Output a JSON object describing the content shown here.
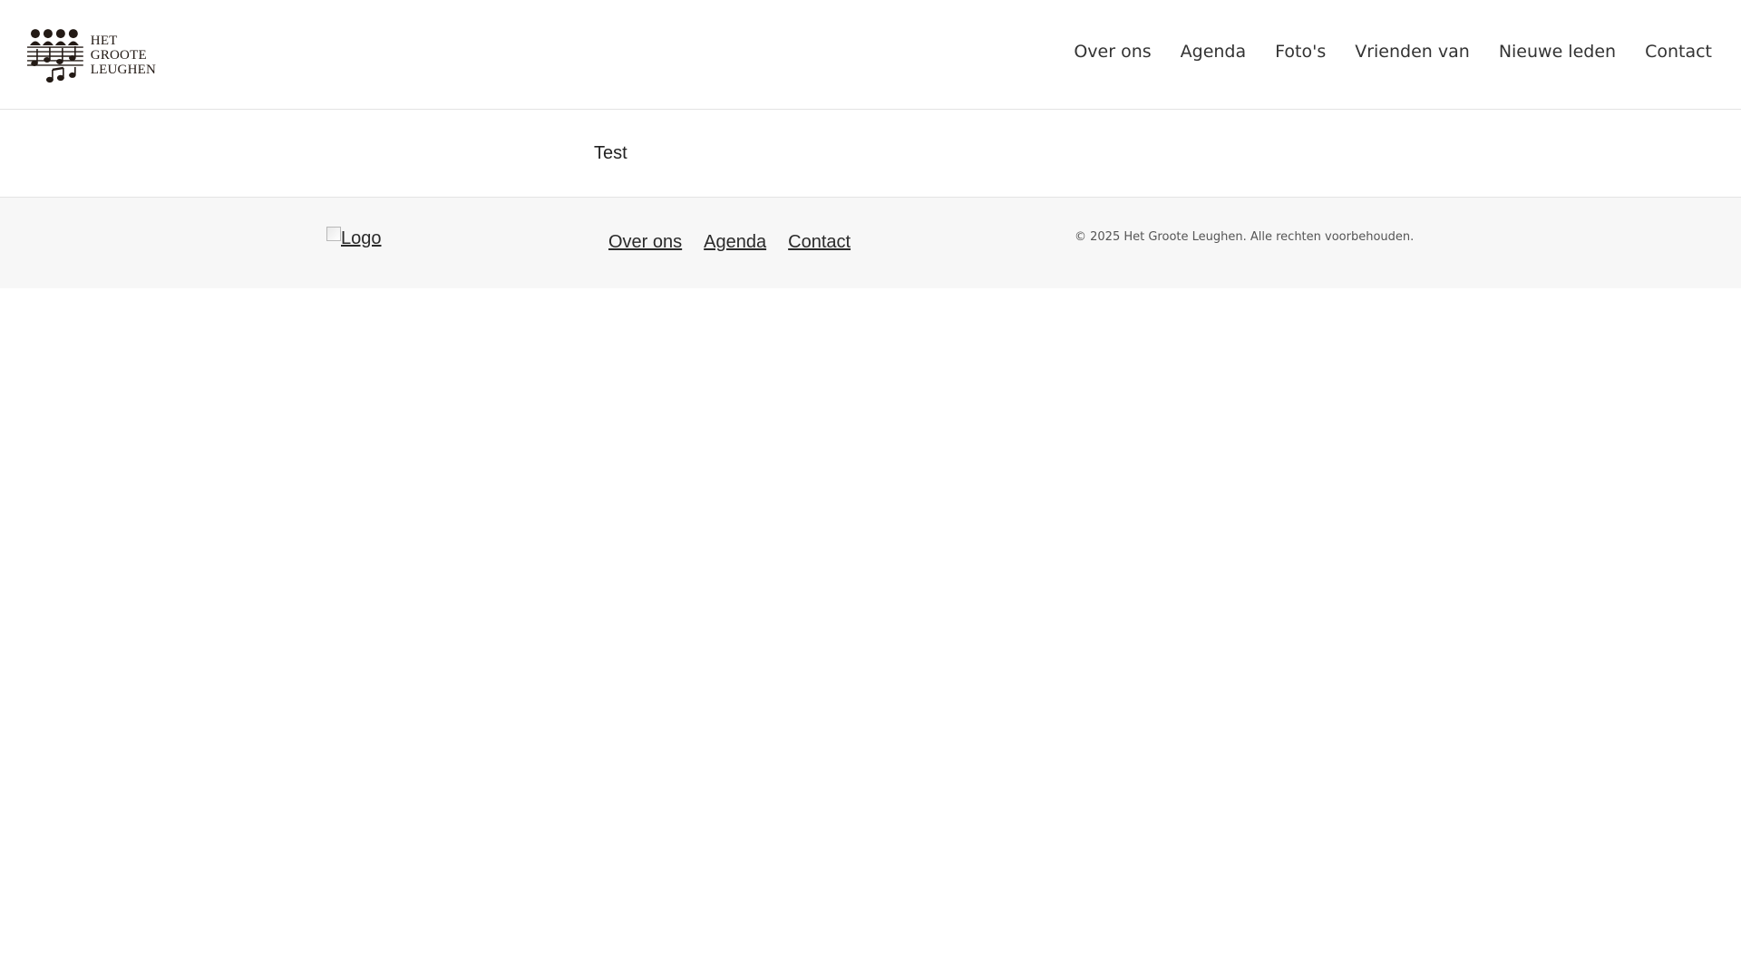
{
  "header": {
    "logo": {
      "line1": "HET",
      "line2": "GROOTE",
      "line3": "LEUGHEN",
      "icon": "choir-music-notes-icon"
    },
    "nav": [
      {
        "label": "Over ons"
      },
      {
        "label": "Agenda"
      },
      {
        "label": "Foto's"
      },
      {
        "label": "Vrienden van"
      },
      {
        "label": "Nieuwe leden"
      },
      {
        "label": "Contact"
      }
    ]
  },
  "main": {
    "text": "Test"
  },
  "footer": {
    "logo_alt": "Logo",
    "links": [
      {
        "label": "Over ons"
      },
      {
        "label": "Agenda"
      },
      {
        "label": "Contact"
      }
    ],
    "copyright": "© 2025 Het Groote Leughen. Alle rechten voorbehouden."
  },
  "colors": {
    "text": "#333333",
    "border": "#e3e3e3",
    "footer_bg": "#f7f7f7",
    "logo": "#231a15"
  }
}
